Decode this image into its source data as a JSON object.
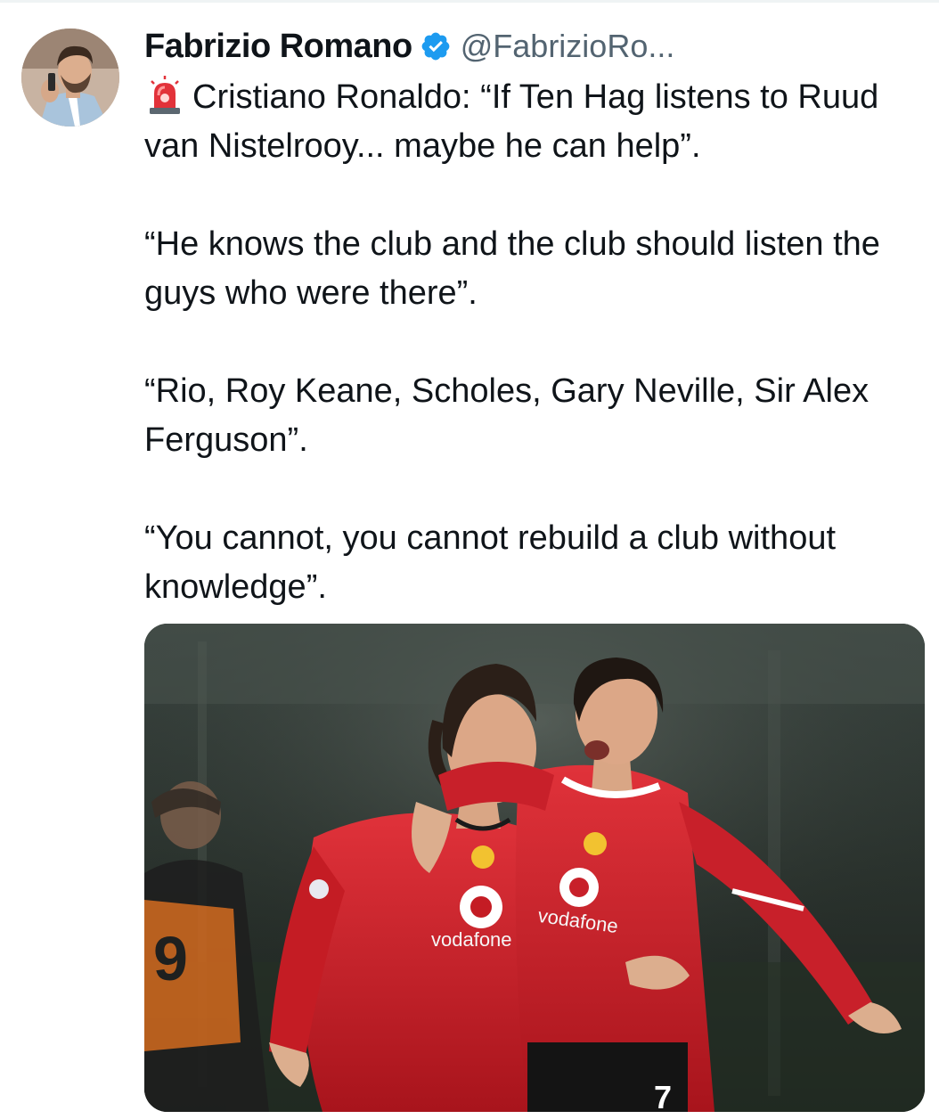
{
  "tweet": {
    "author": {
      "display_name": "Fabrizio Romano",
      "handle": "@FabrizioRo...",
      "verified": true,
      "avatar_icon": "profile-photo"
    },
    "text": {
      "line1": "Cristiano Ronaldo: “If Ten Hag listens to Ruud van Nistelrooy... maybe he can help”.",
      "line2": "“He knows the club and the club should listen the guys who were there”.",
      "line3": "“Rio, Roy Keane, Scholes, Gary Neville, Sir Alex Ferguson”.",
      "line4": "“You cannot, you cannot rebuild a club without knowledge”."
    },
    "emoji": "siren-icon",
    "media": {
      "sponsor_left": "vodafone",
      "sponsor_right": "vodafone",
      "shirt_number": "7",
      "opponent_number": "9"
    }
  },
  "colors": {
    "verified_blue": "#1d9bf0",
    "text_primary": "#0f1419",
    "text_secondary": "#536471",
    "kit_red": "#d3202a"
  }
}
